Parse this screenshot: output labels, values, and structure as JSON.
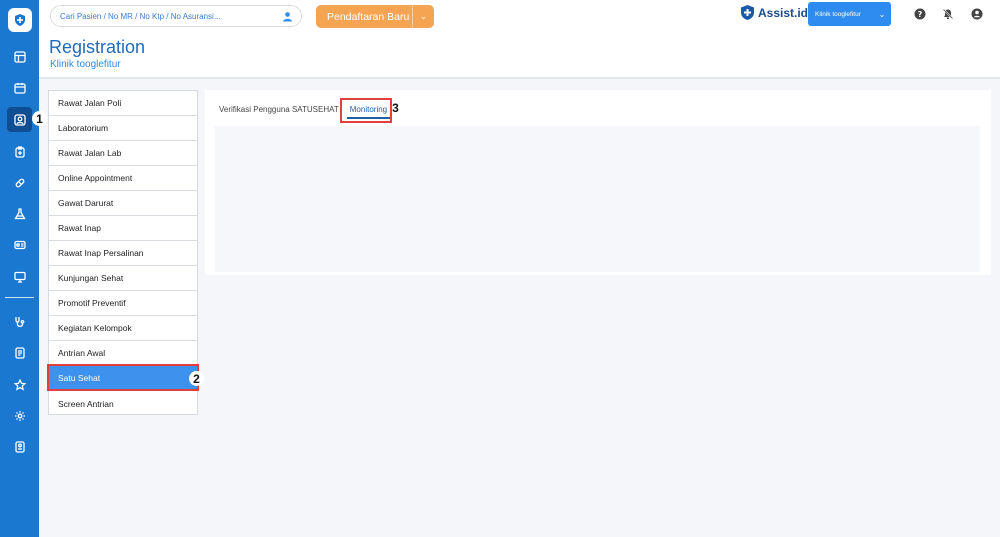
{
  "rail": {
    "icons": [
      "shield-logo-icon",
      "layout-icon",
      "calendar-icon",
      "patient-card-icon",
      "clipboard-icon",
      "pill-icon",
      "lab-flask-icon",
      "id-card-icon",
      "monitor-icon",
      "stethoscope-icon",
      "document-icon",
      "star-icon",
      "settings-icon",
      "report-icon"
    ]
  },
  "topbar": {
    "search_placeholder": "Cari Pasien / No MR / No Ktp / No Asuransi...",
    "register_button": "Pendaftaran Baru",
    "brand": "Assist.id",
    "clinic_selector": "Klinik tooglefitur"
  },
  "header": {
    "title": "Registration",
    "subtitle": "Klinik tooglefitur"
  },
  "menu": {
    "items": [
      "Rawat Jalan Poli",
      "Laboratorium",
      "Rawat Jalan Lab",
      "Online Appointment",
      "Gawat Darurat",
      "Rawat Inap",
      "Rawat Inap Persalinan",
      "Kunjungan Sehat",
      "Promotif Preventif",
      "Kegiatan Kelompok",
      "Antrian Awal",
      "Satu Sehat",
      "Screen Antrian"
    ],
    "active": "Satu Sehat"
  },
  "tabs": {
    "items": [
      "Verifikasi Pengguna SATUSEHAT",
      "Monitoring"
    ],
    "active": "Monitoring"
  },
  "markers": [
    "1",
    "2",
    "3"
  ],
  "colors": {
    "rail": "#1b78d0",
    "accent": "#2e8cf0",
    "register_button": "#f5a552",
    "highlight": "#e2403f"
  }
}
